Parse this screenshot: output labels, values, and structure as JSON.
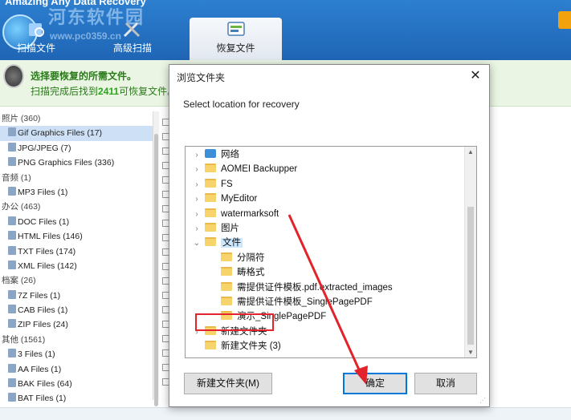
{
  "app": {
    "title": "Amazing Any Data Recovery",
    "watermark": "河东软件园",
    "watermark_url": "www.pc0359.cn",
    "tabs": [
      {
        "label": "扫描文件"
      },
      {
        "label": "高级扫描"
      },
      {
        "label": "恢复文件"
      }
    ],
    "info": {
      "line1": "选择要恢复的所需文件。",
      "line2_prefix": "扫描完成后找到",
      "line2_count": "2411",
      "line2_suffix": "可恢复文件。"
    },
    "left_list": [
      {
        "label": "照片 (360)",
        "kind": "category"
      },
      {
        "label": "Gif Graphics Files (17)",
        "kind": "child",
        "selected": true
      },
      {
        "label": "JPG/JPEG (7)",
        "kind": "child"
      },
      {
        "label": "PNG Graphics Files (336)",
        "kind": "child"
      },
      {
        "label": "音频 (1)",
        "kind": "category"
      },
      {
        "label": "MP3 Files (1)",
        "kind": "child"
      },
      {
        "label": "办公 (463)",
        "kind": "category"
      },
      {
        "label": "DOC Files (1)",
        "kind": "child"
      },
      {
        "label": "HTML Files (146)",
        "kind": "child"
      },
      {
        "label": "TXT Files (174)",
        "kind": "child"
      },
      {
        "label": "XML Files (142)",
        "kind": "child"
      },
      {
        "label": "档案 (26)",
        "kind": "category"
      },
      {
        "label": "7Z Files (1)",
        "kind": "child"
      },
      {
        "label": "CAB Files (1)",
        "kind": "child"
      },
      {
        "label": "ZIP Files (24)",
        "kind": "child"
      },
      {
        "label": "其他 (1561)",
        "kind": "category"
      },
      {
        "label": "3 Files (1)",
        "kind": "child"
      },
      {
        "label": "AA Files (1)",
        "kind": "child"
      },
      {
        "label": "BAK Files (64)",
        "kind": "child"
      },
      {
        "label": "BAT Files (1)",
        "kind": "child"
      }
    ]
  },
  "dialog": {
    "title": "浏览文件夹",
    "close": "✕",
    "description": "Select location for recovery",
    "tree": [
      {
        "label": "网络",
        "icon": "network-icon",
        "chev": "›"
      },
      {
        "label": "AOMEI Backupper",
        "icon": "folder-icon",
        "chev": "›"
      },
      {
        "label": "FS",
        "icon": "folder-icon",
        "chev": "›"
      },
      {
        "label": "MyEditor",
        "icon": "folder-icon",
        "chev": "›"
      },
      {
        "label": "watermarksoft",
        "icon": "folder-icon",
        "chev": "›"
      },
      {
        "label": "图片",
        "icon": "folder-icon",
        "chev": "›"
      },
      {
        "label": "文件",
        "icon": "folder-icon",
        "chev": "⌄",
        "selected": true
      },
      {
        "label": "分隔符",
        "icon": "folder-icon",
        "chev": "",
        "indent": true
      },
      {
        "label": "畴格式",
        "icon": "folder-icon",
        "chev": "",
        "indent": true
      },
      {
        "label": "需提供证件模板.pdf.extracted_images",
        "icon": "folder-icon",
        "chev": "",
        "indent": true
      },
      {
        "label": "需提供证件模板_SinglePagePDF",
        "icon": "folder-icon",
        "chev": "",
        "indent": true
      },
      {
        "label": "演示_SinglePagePDF",
        "icon": "folder-icon",
        "chev": "",
        "indent": true
      },
      {
        "label": "新建文件夹",
        "icon": "folder-icon",
        "chev": "›"
      },
      {
        "label": "新建文件夹 (3)",
        "icon": "folder-icon",
        "chev": ""
      }
    ],
    "buttons": {
      "new_folder": "新建文件夹(M)",
      "ok": "确定",
      "cancel": "取消"
    }
  },
  "colors": {
    "header_blue": "#1f65b5",
    "info_green": "#2a7a1a",
    "annotation_red": "#e2232b",
    "accent_blue": "#0078d7"
  }
}
